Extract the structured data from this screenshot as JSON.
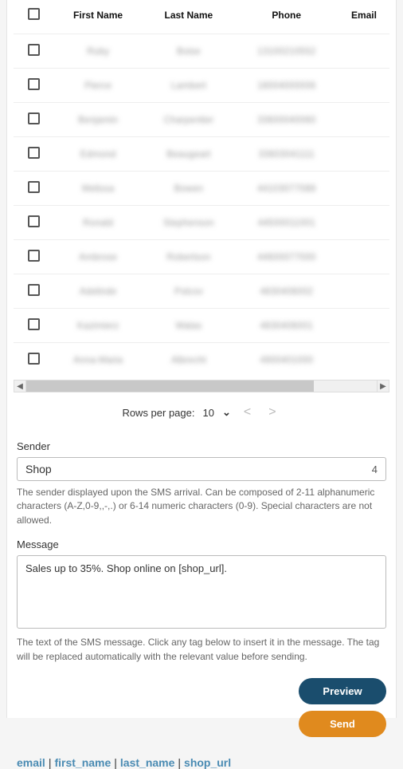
{
  "table": {
    "headers": {
      "first_name": "First Name",
      "last_name": "Last Name",
      "phone": "Phone",
      "email": "Email"
    },
    "rows": [
      {
        "first": "Ruby",
        "last": "Boise",
        "phone": "13100210552"
      },
      {
        "first": "Pierce",
        "last": "Lambert",
        "phone": "18004000006"
      },
      {
        "first": "Benjamin",
        "last": "Charpentier",
        "phone": "33600040060"
      },
      {
        "first": "Edmond",
        "last": "Beaugeart",
        "phone": "33603041111"
      },
      {
        "first": "Melissa",
        "last": "Bowen",
        "phone": "44103077088"
      },
      {
        "first": "Ronald",
        "last": "Stephenson",
        "phone": "44500011001"
      },
      {
        "first": "Ambrose",
        "last": "Robertson",
        "phone": "44600077000"
      },
      {
        "first": "Adelinde",
        "last": "Polcov",
        "phone": "4830406002"
      },
      {
        "first": "Kazimierz",
        "last": "Walas",
        "phone": "4830406001"
      },
      {
        "first": "Anna-Maria",
        "last": "Albrecht",
        "phone": "4900401000"
      }
    ]
  },
  "pager": {
    "label": "Rows per page:",
    "value": "10"
  },
  "sender": {
    "label": "Sender",
    "value": "Shop",
    "counter": "4",
    "helper": "The sender displayed upon the SMS arrival. Can be composed of 2-11 alphanumeric characters (A-Z,0-9,,-,.) or 6-14 numeric characters (0-9). Special characters are not allowed."
  },
  "message": {
    "label": "Message",
    "value": "Sales up to 35%. Shop online on [shop_url].",
    "helper": "The text of the SMS message. Click any tag below to insert it in the message. The tag will be replaced automatically with the relevant value before sending."
  },
  "buttons": {
    "preview": "Preview",
    "send": "Send"
  },
  "tags": [
    "email",
    "first_name",
    "last_name",
    "shop_url"
  ]
}
